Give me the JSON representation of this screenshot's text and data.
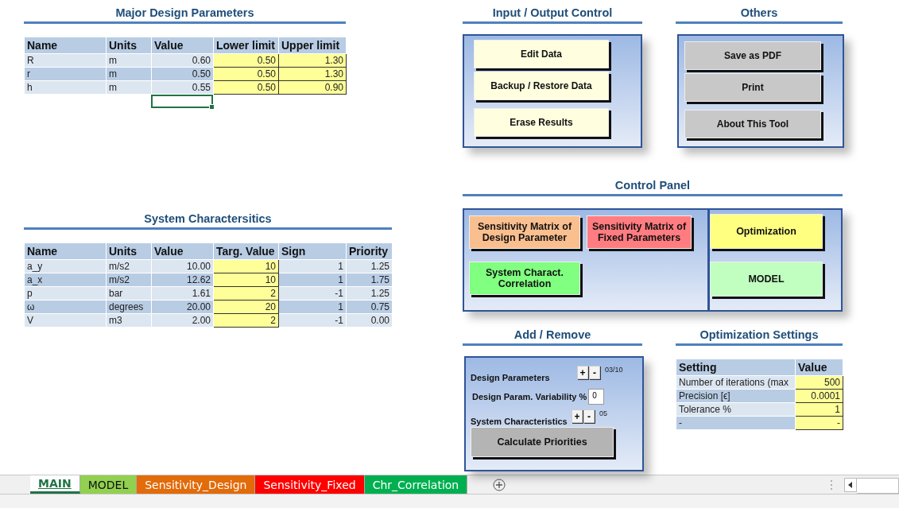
{
  "design_parameters": {
    "title": "Major Design Parameters",
    "columns": [
      {
        "label": "Name",
        "kind": "text"
      },
      {
        "label": "Units",
        "kind": "text"
      },
      {
        "label": "Value",
        "kind": "number"
      },
      {
        "label": "Lower limit",
        "kind": "input"
      },
      {
        "label": "Upper limit",
        "kind": "input"
      }
    ],
    "rows": [
      [
        "R",
        "m",
        "0.60",
        "0.50",
        "1.30"
      ],
      [
        "r",
        "m",
        "0.50",
        "0.50",
        "1.30"
      ],
      [
        "h",
        "m",
        "0.55",
        "0.50",
        "0.90"
      ]
    ],
    "active_cell_below_value": true
  },
  "system_characteristics": {
    "title": "System Charactersitics",
    "columns": [
      {
        "label": "Name",
        "kind": "text"
      },
      {
        "label": "Units",
        "kind": "text"
      },
      {
        "label": "Value",
        "kind": "number"
      },
      {
        "label": "Targ. Value",
        "kind": "input"
      },
      {
        "label": "Sign",
        "kind": "number"
      },
      {
        "label": "Priority",
        "kind": "number"
      }
    ],
    "rows": [
      [
        "a_y",
        "m/s2",
        "10.00",
        "10",
        "1",
        "1.25"
      ],
      [
        "a_x",
        "m/s2",
        "12.62",
        "10",
        "1",
        "1.75"
      ],
      [
        "p",
        "bar",
        "1.61",
        "2",
        "-1",
        "1.25"
      ],
      [
        "ω",
        "degrees",
        "20.00",
        "20",
        "1",
        "0.75"
      ],
      [
        "V",
        "m3",
        "2.00",
        "2",
        "-1",
        "0.00"
      ]
    ]
  },
  "input_output_control": {
    "title": "Input / Output Control",
    "buttons": [
      "Edit Data",
      "Backup / Restore Data",
      "Erase Results"
    ]
  },
  "others": {
    "title": "Others",
    "buttons": [
      "Save as PDF",
      "Print",
      "About This Tool"
    ]
  },
  "control_panel": {
    "title": "Control Panel",
    "left_buttons": [
      {
        "label": "Sensitivity Matrix of Design Parameter",
        "color": "#fabf8f"
      },
      {
        "label": "Sensitivity Matrix of Fixed Parameters",
        "color": "#ff7c80"
      },
      {
        "label": "System Charact. Correlation",
        "color": "#80ff80"
      }
    ],
    "right_buttons": [
      {
        "label": "Optimization",
        "color": "#ffff80"
      },
      {
        "label": "MODEL",
        "color": "#c0ffc0"
      }
    ]
  },
  "add_remove": {
    "title": "Add / Remove",
    "rows": [
      {
        "kind": "stepper",
        "label": "Design Parameters",
        "plus": "+",
        "minus": "-",
        "count": "03/10"
      },
      {
        "kind": "field",
        "label": "Design Param. Variability %",
        "value": "0"
      },
      {
        "kind": "stepper",
        "label": "System Characteristics",
        "plus": "+",
        "minus": "-",
        "count": "05"
      }
    ],
    "button": "Calculate Priorities"
  },
  "optimization_settings": {
    "title": "Optimization Settings",
    "columns": [
      {
        "label": "Setting",
        "kind": "text"
      },
      {
        "label": "Value",
        "kind": "input"
      }
    ],
    "rows": [
      [
        "Number of iterations (max",
        "500"
      ],
      [
        "Precision [ϵ]",
        "0.0001"
      ],
      [
        "Tolerance %",
        "1"
      ],
      [
        "-",
        "-"
      ]
    ]
  },
  "sheet_tabs": [
    {
      "label": "MAIN",
      "selected": true,
      "color": "#ffffff"
    },
    {
      "label": "MODEL",
      "selected": false,
      "color": "#92d050"
    },
    {
      "label": "Sensitivity_Design",
      "selected": false,
      "color": "#e26b0a"
    },
    {
      "label": "Sensitivity_Fixed",
      "selected": false,
      "color": "#ff0000"
    },
    {
      "label": "Chr_Correlation",
      "selected": false,
      "color": "#00b050"
    }
  ]
}
